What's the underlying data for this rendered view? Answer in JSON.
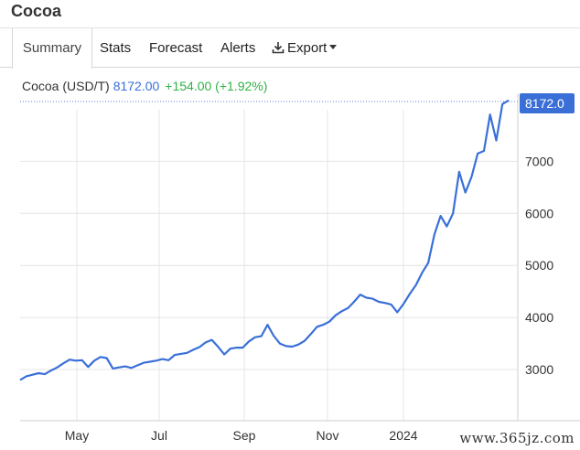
{
  "title": "Cocoa",
  "tabs": [
    {
      "label": "Summary"
    },
    {
      "label": "Stats"
    },
    {
      "label": "Forecast"
    },
    {
      "label": "Alerts"
    },
    {
      "label": "Export"
    }
  ],
  "legend": {
    "name": "Cocoa (USD/T)",
    "value": "8172.00",
    "change": "+154.00 (+1.92%)"
  },
  "current_label": "8172.0",
  "colors": {
    "line": "#3a6fd8",
    "badge": "#3a6fd8",
    "change": "#2fb344"
  },
  "watermark": "www.365jz.com",
  "chart_data": {
    "type": "line",
    "x_ticks": [
      "May",
      "Jul",
      "Sep",
      "Nov",
      "2024"
    ],
    "y_ticks": [
      3000,
      4000,
      5000,
      6000,
      7000
    ],
    "ylim": [
      2500,
      8500
    ],
    "grid": true,
    "series": [
      {
        "values": [
          [
            0,
            2800
          ],
          [
            1,
            2870
          ],
          [
            2,
            2900
          ],
          [
            3,
            2930
          ],
          [
            4,
            2910
          ],
          [
            5,
            2980
          ],
          [
            6,
            3040
          ],
          [
            7,
            3120
          ],
          [
            8,
            3190
          ],
          [
            9,
            3170
          ],
          [
            10,
            3180
          ],
          [
            11,
            3050
          ],
          [
            12,
            3170
          ],
          [
            13,
            3240
          ],
          [
            14,
            3220
          ],
          [
            15,
            3020
          ],
          [
            16,
            3040
          ],
          [
            17,
            3060
          ],
          [
            18,
            3030
          ],
          [
            19,
            3080
          ],
          [
            20,
            3130
          ],
          [
            21,
            3150
          ],
          [
            22,
            3170
          ],
          [
            23,
            3200
          ],
          [
            24,
            3180
          ],
          [
            25,
            3280
          ],
          [
            26,
            3300
          ],
          [
            27,
            3320
          ],
          [
            28,
            3380
          ],
          [
            29,
            3430
          ],
          [
            30,
            3520
          ],
          [
            31,
            3570
          ],
          [
            32,
            3440
          ],
          [
            33,
            3290
          ],
          [
            34,
            3400
          ],
          [
            35,
            3420
          ],
          [
            36,
            3420
          ],
          [
            37,
            3540
          ],
          [
            38,
            3620
          ],
          [
            39,
            3640
          ],
          [
            40,
            3860
          ],
          [
            41,
            3650
          ],
          [
            42,
            3500
          ],
          [
            43,
            3450
          ],
          [
            44,
            3440
          ],
          [
            45,
            3480
          ],
          [
            46,
            3550
          ],
          [
            47,
            3680
          ],
          [
            48,
            3820
          ],
          [
            49,
            3860
          ],
          [
            50,
            3920
          ],
          [
            51,
            4040
          ],
          [
            52,
            4120
          ],
          [
            53,
            4180
          ],
          [
            54,
            4300
          ],
          [
            55,
            4440
          ],
          [
            56,
            4380
          ],
          [
            57,
            4360
          ],
          [
            58,
            4300
          ],
          [
            59,
            4280
          ],
          [
            60,
            4250
          ],
          [
            61,
            4100
          ],
          [
            62,
            4260
          ],
          [
            63,
            4450
          ],
          [
            64,
            4620
          ],
          [
            65,
            4860
          ],
          [
            66,
            5050
          ],
          [
            67,
            5600
          ],
          [
            68,
            5950
          ],
          [
            69,
            5750
          ],
          [
            70,
            6000
          ],
          [
            71,
            6800
          ],
          [
            72,
            6400
          ],
          [
            73,
            6700
          ],
          [
            74,
            7150
          ],
          [
            75,
            7200
          ],
          [
            76,
            7900
          ],
          [
            77,
            7400
          ],
          [
            78,
            8100
          ],
          [
            79,
            8172
          ]
        ]
      }
    ]
  }
}
